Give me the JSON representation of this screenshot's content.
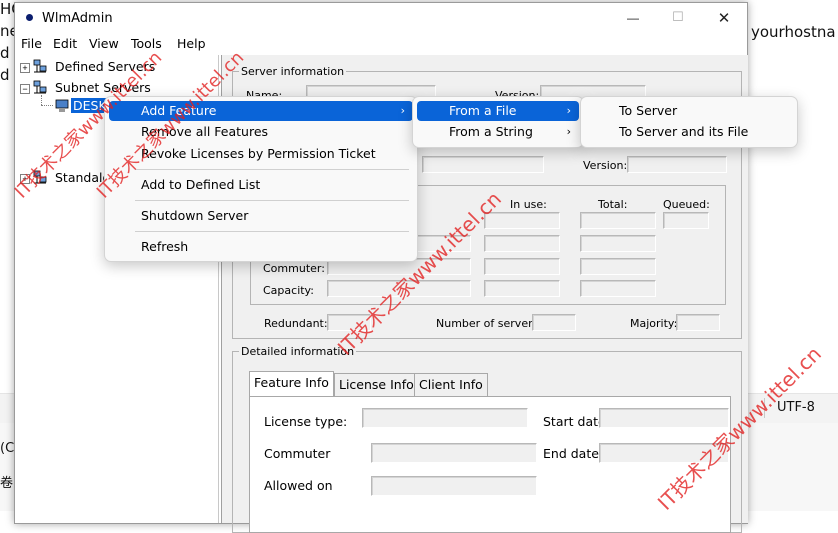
{
  "background": {
    "left_fragments": [
      "HC",
      "ne",
      "d i",
      "d y"
    ],
    "right_text": "yourhostna",
    "status_right": "UTF-8",
    "bottom_left_1": "(C",
    "bottom_left_2": "卷"
  },
  "window": {
    "title": "WlmAdmin",
    "controls": {
      "minimize": "—",
      "maximize": "☐",
      "close": "✕"
    }
  },
  "menubar": [
    "File",
    "Edit",
    "View",
    "Tools",
    "Help"
  ],
  "tree": {
    "defined": "Defined Servers",
    "subnet": "Subnet Servers",
    "desk": "DESK",
    "standalone": "Standalo"
  },
  "server_info": {
    "group_label": "Server information",
    "name_label": "Name:",
    "version_label": "Version:",
    "version2_label": "Version:",
    "in_use": "In use:",
    "total": "Total:",
    "queued": "Queued:",
    "commuter": "Commuter:",
    "capacity": "Capacity:",
    "redundant": "Redundant:",
    "num_servers": "Number of servers:",
    "majority": "Majority:"
  },
  "detailed": {
    "group_label": "Detailed information",
    "tabs": [
      "Feature Info",
      "License Info",
      "Client Info"
    ],
    "license_type": "License type:",
    "start_date": "Start date",
    "commuter": "Commuter",
    "end_date": "End date:",
    "allowed_on": "Allowed on"
  },
  "context_menu": {
    "items": [
      "Add Feature",
      "Remove all Features",
      "Revoke Licenses by Permission Ticket",
      "Add to Defined List",
      "Shutdown Server",
      "Refresh"
    ]
  },
  "submenu1": [
    "From a File",
    "From a String"
  ],
  "submenu2": [
    "To Server",
    "To Server and its File"
  ],
  "watermarks": [
    "IT技术之家www.ittel.cn",
    "IT技术之家www.ittel.cn",
    "IT技术之家www.ittel.cn",
    "IT技术之家www.ittel.cn"
  ],
  "colors": {
    "highlight": "#0a64d8",
    "watermark": "#e11e1e"
  }
}
